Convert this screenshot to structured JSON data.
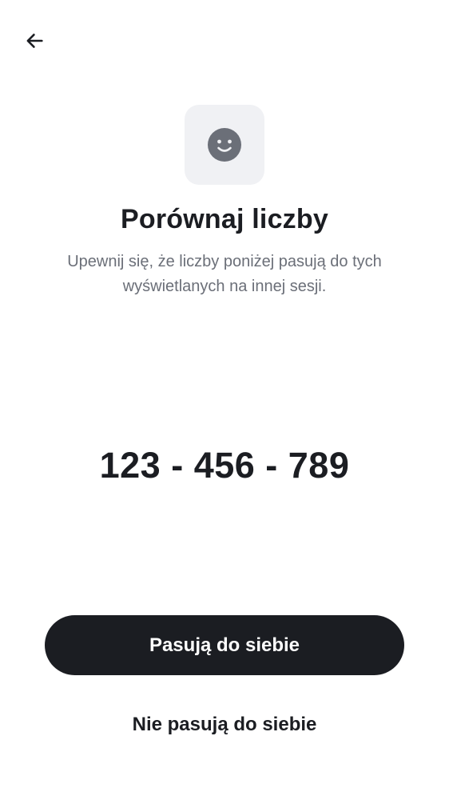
{
  "header": {
    "back_icon": "arrow-left-icon"
  },
  "icon_tile": {
    "icon": "smiley-face-icon",
    "tile_color": "#f0f1f4",
    "icon_color": "#6b6f78"
  },
  "content": {
    "title": "Porównaj liczby",
    "subtitle": "Upewnij się, że liczby poniżej pasują do tych wyświetlanych na innej sesji.",
    "code": "123 - 456 - 789"
  },
  "actions": {
    "primary_label": "Pasują do siebie",
    "secondary_label": "Nie pasują do siebie"
  },
  "colors": {
    "primary_button": "#1b1d22",
    "text_primary": "#1b1d22",
    "text_secondary": "#6b6f78"
  }
}
